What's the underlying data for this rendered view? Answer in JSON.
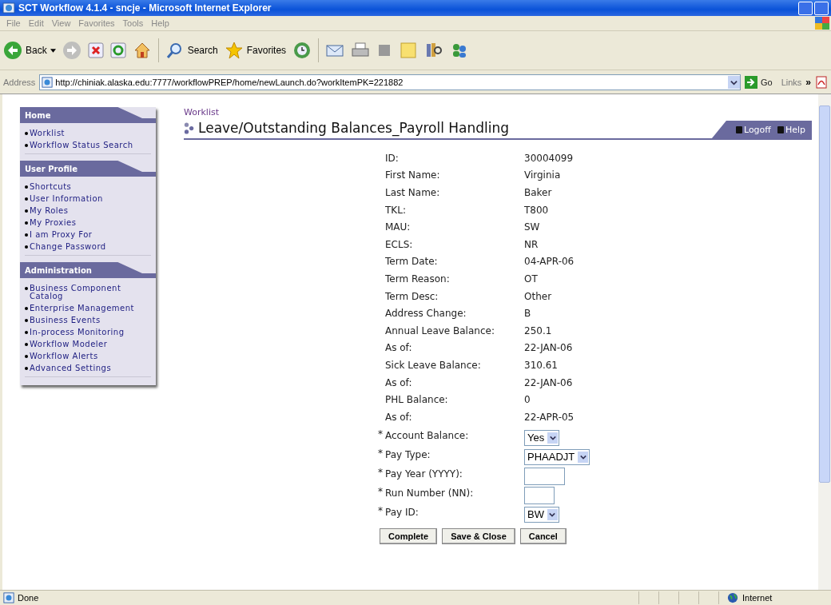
{
  "window": {
    "title": "SCT Workflow 4.1.4 - sncje - Microsoft Internet Explorer"
  },
  "menu_bar": [
    "File",
    "Edit",
    "View",
    "Favorites",
    "Tools",
    "Help"
  ],
  "toolbar": {
    "back": "Back",
    "search": "Search",
    "favorites": "Favorites"
  },
  "address_bar": {
    "label": "Address",
    "url": "http://chiniak.alaska.edu:7777/workflowPREP/home/newLaunch.do?workItemPK=221882",
    "go": "Go",
    "links": "Links",
    "more": "»"
  },
  "sidebar": [
    {
      "title": "Home",
      "items": [
        "Worklist",
        "Workflow Status Search"
      ]
    },
    {
      "title": "User Profile",
      "items": [
        "Shortcuts",
        "User Information",
        "My Roles",
        "My Proxies",
        "I am Proxy For",
        "Change Password"
      ]
    },
    {
      "title": "Administration",
      "items": [
        "Business Component Catalog",
        "Enterprise Management",
        "Business Events",
        "In-process Monitoring",
        "Workflow Modeler",
        "Workflow Alerts",
        "Advanced Settings"
      ]
    }
  ],
  "breadcrumb": "Worklist",
  "page_title": "Leave/Outstanding Balances_Payroll Handling",
  "header_links": [
    "Logoff",
    "Help"
  ],
  "fields": [
    {
      "kind": "text",
      "label": "ID:",
      "value": "30004099"
    },
    {
      "kind": "text",
      "label": "First Name:",
      "value": "Virginia"
    },
    {
      "kind": "text",
      "label": "Last Name:",
      "value": "Baker"
    },
    {
      "kind": "text",
      "label": "TKL:",
      "value": "T800"
    },
    {
      "kind": "text",
      "label": "MAU:",
      "value": "SW"
    },
    {
      "kind": "text",
      "label": "ECLS:",
      "value": "NR"
    },
    {
      "kind": "text",
      "label": "Term Date:",
      "value": "04-APR-06"
    },
    {
      "kind": "text",
      "label": "Term Reason:",
      "value": "OT"
    },
    {
      "kind": "text",
      "label": "Term Desc:",
      "value": "Other"
    },
    {
      "kind": "text",
      "label": "Address Change:",
      "value": "B"
    },
    {
      "kind": "text",
      "label": "Annual Leave Balance:",
      "value": "250.1"
    },
    {
      "kind": "text",
      "label": "As of:",
      "value": "22-JAN-06"
    },
    {
      "kind": "text",
      "label": "Sick Leave Balance:",
      "value": "310.61"
    },
    {
      "kind": "text",
      "label": "As of:",
      "value": "22-JAN-06"
    },
    {
      "kind": "text",
      "label": "PHL Balance:",
      "value": "0"
    },
    {
      "kind": "text",
      "label": "As of:",
      "value": "22-APR-05"
    },
    {
      "kind": "select",
      "mark": "*",
      "label": "Account Balance:",
      "value": "Yes"
    },
    {
      "kind": "select",
      "mark": "*",
      "label": "Pay Type:",
      "value": "PHAADJT"
    },
    {
      "kind": "wide_input",
      "mark": "*",
      "label": "Pay Year (YYYY):"
    },
    {
      "kind": "narrow_input",
      "mark": "*",
      "label": "Run Number (NN):"
    },
    {
      "kind": "select",
      "mark": "*",
      "label": "Pay ID:",
      "value": "BW"
    }
  ],
  "buttons": [
    "Complete",
    "Save & Close",
    "Cancel"
  ],
  "status_bar": {
    "text": "Done",
    "zone": "Internet"
  }
}
